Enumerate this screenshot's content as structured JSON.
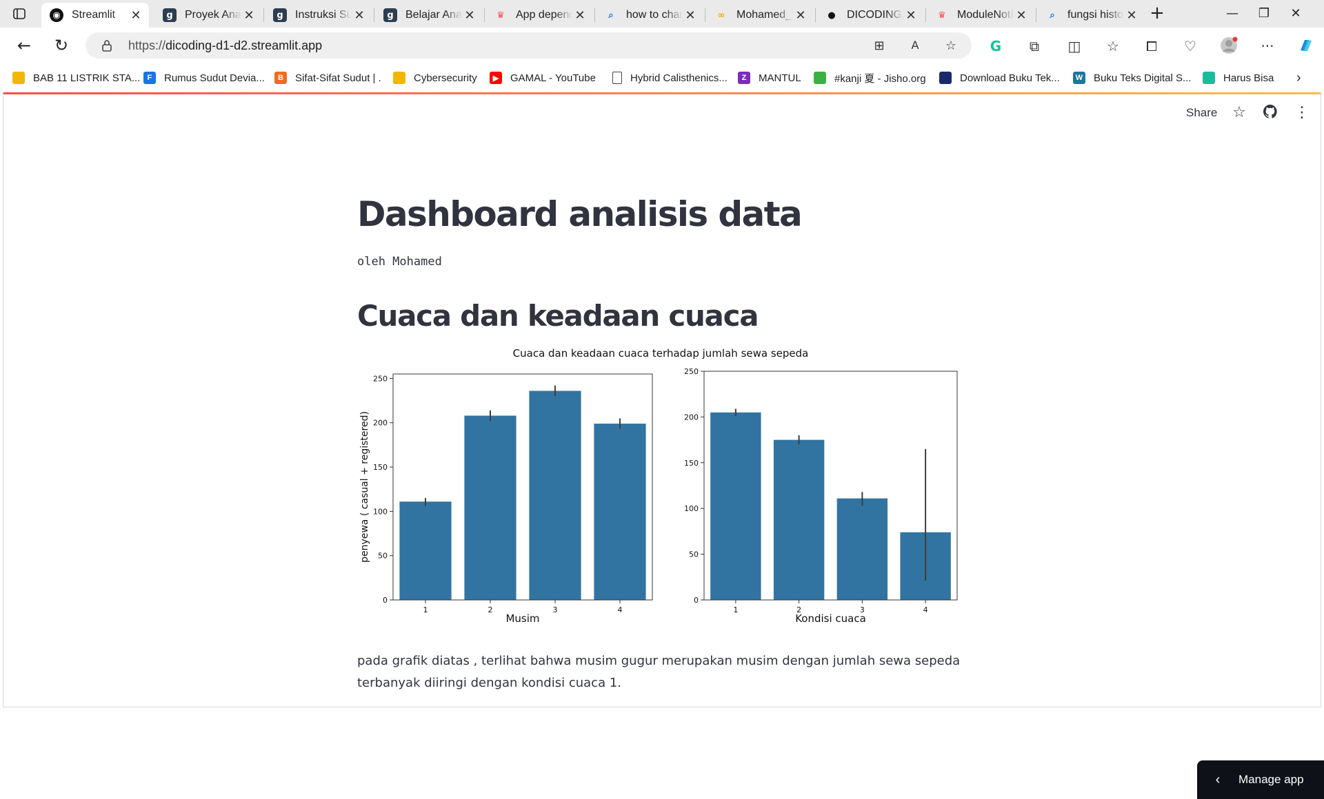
{
  "browser": {
    "tabs": [
      {
        "title": "Streamlit",
        "icon": "streamlit-icon",
        "active": true
      },
      {
        "title": "Proyek Analisis Data",
        "icon": "dicoding-icon"
      },
      {
        "title": "Instruksi Submission",
        "icon": "dicoding-icon"
      },
      {
        "title": "Belajar Analisis Data",
        "icon": "dicoding-icon"
      },
      {
        "title": "App dependencies",
        "icon": "streamlit-crown-icon"
      },
      {
        "title": "how to change",
        "icon": "search-icon"
      },
      {
        "title": "Mohamed_Dicoding",
        "icon": "colab-icon"
      },
      {
        "title": "DICODING/",
        "icon": "github-icon"
      },
      {
        "title": "ModuleNotFoundError",
        "icon": "streamlit-crown-icon"
      },
      {
        "title": "fungsi histogram",
        "icon": "search-icon"
      }
    ],
    "url_protocol": "https://",
    "url_host": "dicoding-d1-d2.streamlit.app",
    "bookmarks": [
      {
        "label": "BAB 11 LISTRIK STA...",
        "color": "#f2b705"
      },
      {
        "label": "Rumus Sudut Devia...",
        "color": "#1a73e8",
        "glyph": "F"
      },
      {
        "label": "Sifat-Sifat Sudut | .",
        "color": "#f26b1d",
        "glyph": "B"
      },
      {
        "label": "Cybersecurity",
        "color": "#f2b705"
      },
      {
        "label": "GAMAL - YouTube",
        "color": "#ff0000",
        "glyph": "▶"
      },
      {
        "label": "Hybrid Calisthenics...",
        "color": "#ffffff"
      },
      {
        "label": "MANTUL",
        "color": "#7b2cbf",
        "glyph": "Z"
      },
      {
        "label": "#kanji 夏 - Jisho.org",
        "color": "#3cb043"
      },
      {
        "label": "Download Buku Tek...",
        "color": "#1b2a6b"
      },
      {
        "label": "Buku Teks Digital S...",
        "color": "#21759b",
        "glyph": "W"
      },
      {
        "label": "Harus Bisa",
        "color": "#1abc9c"
      }
    ]
  },
  "app": {
    "share_label": "Share",
    "title": "Dashboard analisis data",
    "byline": "oleh Mohamed",
    "section_title": "Cuaca dan keadaan cuaca",
    "paragraph": "pada grafik diatas , terlihat bahwa musim gugur merupakan musim dengan jumlah sewa sepeda terbanyak diiringi dengan kondisi cuaca 1.",
    "manage_label": "Manage app",
    "accent": "#ff4b4b"
  },
  "chart_data": [
    {
      "type": "bar",
      "title": "Cuaca dan keadaan cuaca terhadap jumlah sewa sepeda",
      "categories": [
        "1",
        "2",
        "3",
        "4"
      ],
      "values": [
        111,
        208,
        236,
        199
      ],
      "error": [
        [
          106,
          115
        ],
        [
          202,
          214
        ],
        [
          230,
          242
        ],
        [
          193,
          205
        ]
      ],
      "xlabel": "Musim",
      "ylabel": "penyewa ( casual + registered)",
      "ylim": [
        0,
        255
      ],
      "yticks": [
        0,
        50,
        100,
        150,
        200,
        250
      ],
      "color": "#3274a1"
    },
    {
      "type": "bar",
      "categories": [
        "1",
        "2",
        "3",
        "4"
      ],
      "values": [
        205,
        175,
        111,
        74
      ],
      "error": [
        [
          201,
          209
        ],
        [
          170,
          180
        ],
        [
          103,
          118
        ],
        [
          21,
          165
        ]
      ],
      "xlabel": "Kondisi cuaca",
      "ylabel": "",
      "ylim": [
        0,
        250
      ],
      "yticks": [
        0,
        50,
        100,
        150,
        200,
        250
      ],
      "color": "#3274a1"
    }
  ]
}
